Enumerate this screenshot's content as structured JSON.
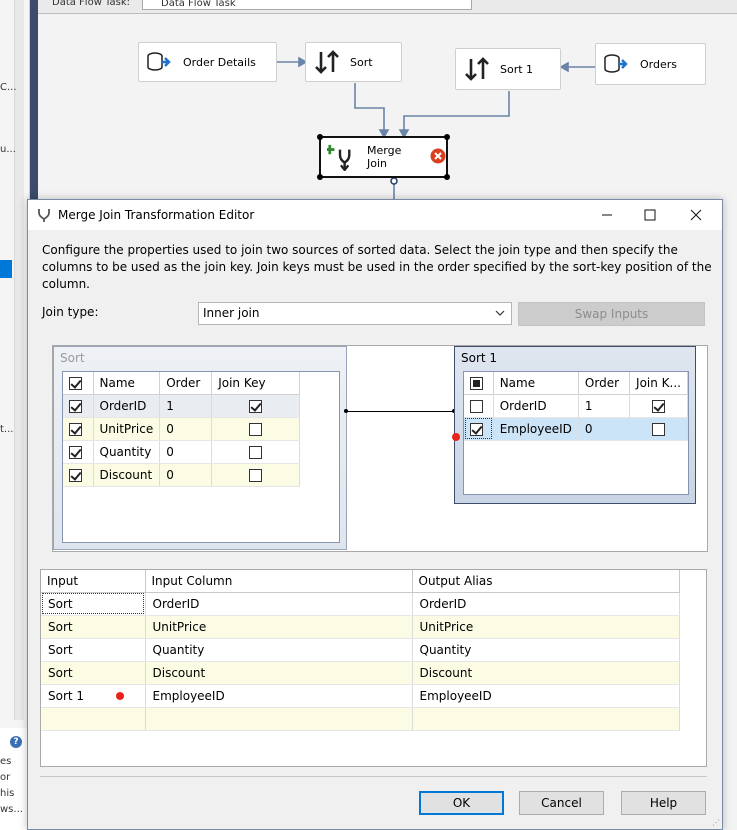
{
  "designer": {
    "header": {
      "left_text": "Data Flow Task:",
      "tab_text": "Data Flow Task"
    },
    "left_fragments": [
      "C...",
      "u...",
      "t...",
      "es",
      "or",
      "his",
      "ws..."
    ],
    "nodes": {
      "order_details": {
        "label": "Order Details",
        "icon": "source-icon"
      },
      "sort": {
        "label": "Sort",
        "icon": "sort-icon"
      },
      "sort1": {
        "label": "Sort 1",
        "icon": "sort-icon"
      },
      "orders": {
        "label": "Orders",
        "icon": "source-icon"
      },
      "merge_join": {
        "label": "Merge Join",
        "icon": "merge-join-icon",
        "status_icon": "error-icon"
      }
    }
  },
  "dialog": {
    "title": "Merge Join Transformation Editor",
    "description": "Configure the properties used to join two sources of sorted data. Select the join type and then specify the columns to be used as the join key. Join keys must be used in the order specified by the sort-key position of the column.",
    "join_type_label": "Join type:",
    "join_type_value": "Inner join",
    "swap_inputs_label": "Swap Inputs",
    "left_input": {
      "title": "Sort",
      "columns": [
        "Name",
        "Order",
        "Join Key"
      ],
      "header_checked": true,
      "rows": [
        {
          "checked": true,
          "name": "OrderID",
          "order": "1",
          "join_key": true
        },
        {
          "checked": true,
          "name": "UnitPrice",
          "order": "0",
          "join_key": false
        },
        {
          "checked": true,
          "name": "Quantity",
          "order": "0",
          "join_key": false
        },
        {
          "checked": true,
          "name": "Discount",
          "order": "0",
          "join_key": false
        }
      ]
    },
    "right_input": {
      "title": "Sort 1",
      "columns": [
        "Name",
        "Order",
        "Join K..."
      ],
      "header_checked": "partial",
      "rows": [
        {
          "checked": false,
          "name": "OrderID",
          "order": "1",
          "join_key": true
        },
        {
          "checked": true,
          "name": "EmployeeID",
          "order": "0",
          "join_key": false,
          "selected": true
        }
      ]
    },
    "output": {
      "columns": [
        "Input",
        "Input Column",
        "Output Alias"
      ],
      "rows": [
        {
          "input": "Sort",
          "input_column": "OrderID",
          "output_alias": "OrderID"
        },
        {
          "input": "Sort",
          "input_column": "UnitPrice",
          "output_alias": "UnitPrice"
        },
        {
          "input": "Sort",
          "input_column": "Quantity",
          "output_alias": "Quantity"
        },
        {
          "input": "Sort",
          "input_column": "Discount",
          "output_alias": "Discount"
        },
        {
          "input": "Sort 1",
          "input_column": "EmployeeID",
          "output_alias": "EmployeeID"
        }
      ]
    },
    "buttons": {
      "ok": "OK",
      "cancel": "Cancel",
      "help": "Help"
    }
  },
  "colors": {
    "accent": "#0078d7",
    "row_alt": "#fcfbe4",
    "selection": "#cce4f7",
    "error": "#e8231a"
  }
}
